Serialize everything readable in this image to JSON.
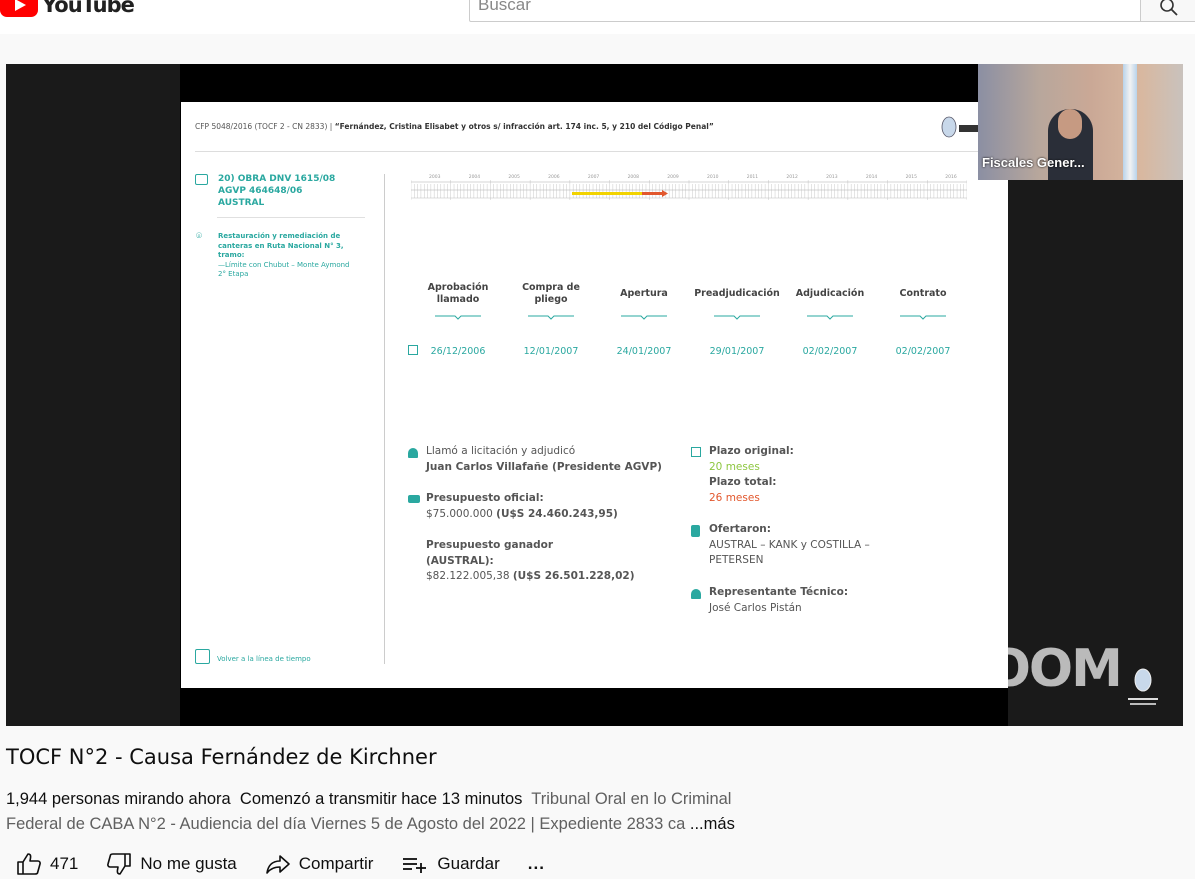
{
  "header": {
    "logo_text": "YouTube",
    "search_placeholder": "Buscar"
  },
  "slide": {
    "case_ref": "CFP 5048/2016 (TOCF 2 - CN 2833) |",
    "case_title": "“Fernández, Cristina Elisabet y otros s/ infracción art. 174 inc. 5, y 210 del Código Penal”",
    "obra_title": "20) OBRA DNV 1615/08\nAGVP 464648/06\nAUSTRAL",
    "obra_desc_bold": "Restauración y remediación de canteras en Ruta Nacional N° 3, tramo:",
    "obra_desc": "—Límite con Chubut – Monte Aymond 2° Etapa",
    "back_link": "Volver a la línea de tiempo",
    "timeline_years": [
      "2003",
      "2004",
      "2005",
      "2006",
      "2007",
      "2008",
      "2009",
      "2010",
      "2011",
      "2012",
      "2013",
      "2014",
      "2015",
      "2016"
    ],
    "stages": [
      {
        "label": "Aprobación\nllamado",
        "date": "26/12/2006"
      },
      {
        "label": "Compra de\npliego",
        "date": "12/01/2007"
      },
      {
        "label": "Apertura",
        "date": "24/01/2007"
      },
      {
        "label": "Preadjudicación",
        "date": "29/01/2007"
      },
      {
        "label": "Adjudicación",
        "date": "02/02/2007"
      },
      {
        "label": "Contrato",
        "date": "02/02/2007"
      }
    ],
    "llamo_label": "Llamó a licitación y adjudicó",
    "llamo_value": "Juan Carlos Villafañe (Presidente AGVP)",
    "presupuesto_oficial_label": "Presupuesto oficial:",
    "presupuesto_oficial_ars": "$75.000.000",
    "presupuesto_oficial_usd": "(U$S 24.460.243,95)",
    "presupuesto_ganador_label": "Presupuesto ganador\n(AUSTRAL):",
    "presupuesto_ganador_ars": "$82.122.005,38",
    "presupuesto_ganador_usd": "(U$S 26.501.228,02)",
    "plazo_original_label": "Plazo original:",
    "plazo_original_value": "20 meses",
    "plazo_total_label": "Plazo total:",
    "plazo_total_value": "26 meses",
    "ofertaron_label": "Ofertaron:",
    "ofertaron_value": "AUSTRAL – KANK y COSTILLA –\nPETERSEN",
    "representante_label": "Representante Técnico:",
    "representante_value": "José Carlos Pistán"
  },
  "player": {
    "zoom_watermark": "ZOOM",
    "camera_label": "Fiscales Gener..."
  },
  "video": {
    "title": "TOCF N°2 - Causa Fernández de Kirchner",
    "viewers": "1,944 personas mirando ahora",
    "started": "Comenzó a transmitir hace 13 minutos",
    "desc_line1": "Tribunal Oral en lo Criminal",
    "desc_line2": "Federal de CABA N°2 - Audiencia del día Viernes 5 de Agosto del 2022 | Expediente 2833 ca",
    "more": "...más"
  },
  "actions": {
    "likes": "471",
    "dislike_label": "No me gusta",
    "share_label": "Compartir",
    "save_label": "Guardar",
    "more_label": "..."
  },
  "colors": {
    "teal": "#2aa8a0",
    "green": "#8dc63f",
    "orange": "#e2572d",
    "youtube_red": "#ff0000"
  }
}
